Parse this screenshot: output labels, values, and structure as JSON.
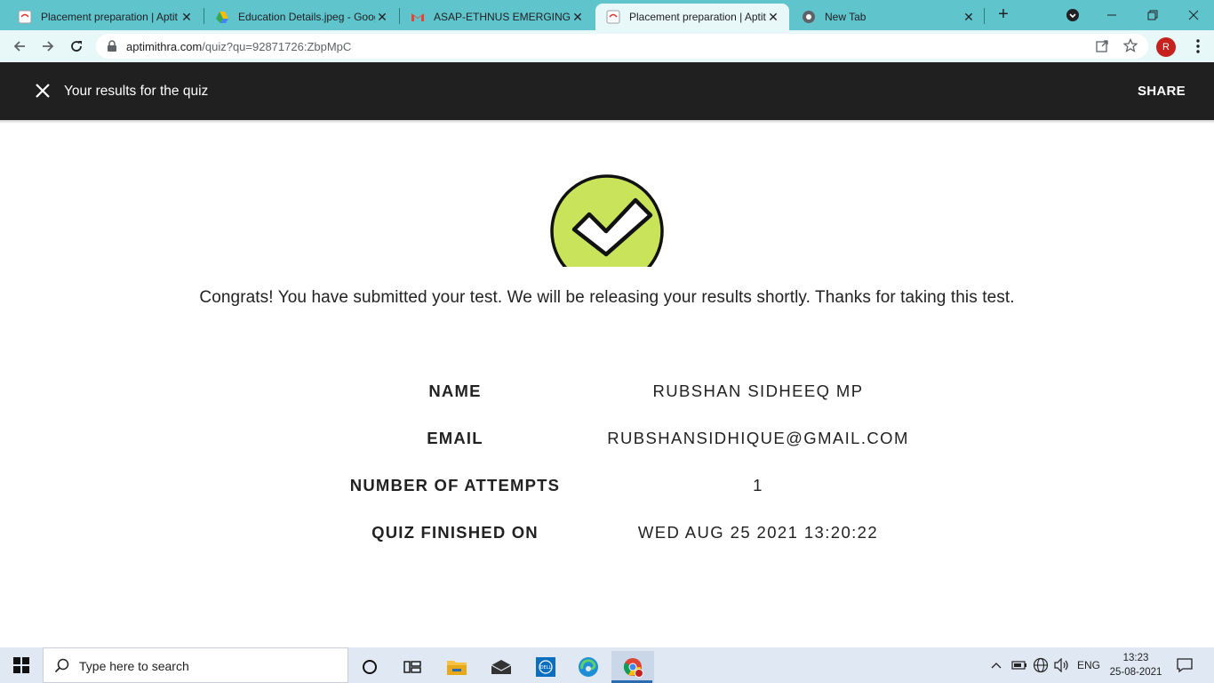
{
  "browser": {
    "tabs": [
      {
        "title": "Placement preparation | Aptit",
        "icon": "aptimithra-favicon",
        "active": false
      },
      {
        "title": "Education Details.jpeg - Goog",
        "icon": "google-drive-icon",
        "active": false
      },
      {
        "title": "ASAP-ETHNUS EMERGING TE",
        "icon": "gmail-icon",
        "active": false
      },
      {
        "title": "Placement preparation | Aptit",
        "icon": "aptimithra-favicon",
        "active": true
      },
      {
        "title": "New Tab",
        "icon": "chrome-icon",
        "active": false
      }
    ],
    "address": {
      "host": "aptimithra.com",
      "path": "/quiz?qu=92871726:ZbpMpC"
    },
    "profile_initial": "R"
  },
  "appbar": {
    "title": "Your results for the quiz",
    "share_label": "SHARE"
  },
  "content": {
    "message": "Congrats! You have submitted your test. We will be releasing your results shortly. Thanks for taking this test.",
    "details": [
      {
        "label": "NAME",
        "value": "RUBSHAN SIDHEEQ MP"
      },
      {
        "label": "EMAIL",
        "value": "RUBSHANSIDHIQUE@GMAIL.COM"
      },
      {
        "label": "NUMBER OF ATTEMPTS",
        "value": "1"
      },
      {
        "label": "QUIZ FINISHED ON",
        "value": "WED AUG 25 2021 13:20:22"
      }
    ]
  },
  "taskbar": {
    "search_placeholder": "Type here to search",
    "language": "ENG",
    "time": "13:23",
    "date": "25-08-2021"
  },
  "colors": {
    "tabstrip": "#5fc4cc",
    "appbar": "#202020",
    "check_fill": "#c9e35a"
  }
}
